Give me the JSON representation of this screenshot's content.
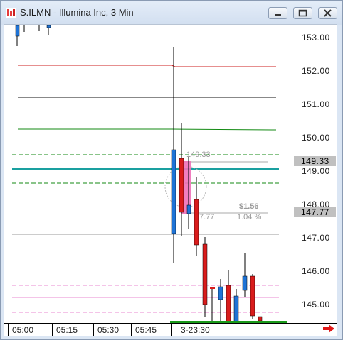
{
  "window": {
    "title": "S.ILMN - Illumina Inc, 3 Min",
    "accent_red": "#e53c3c",
    "icons": [
      "app-icon",
      "minimize-icon",
      "maximize-icon",
      "close-icon"
    ]
  },
  "price_axis": {
    "ticks": [
      "153.00",
      "152.00",
      "151.00",
      "150.00",
      "149.00",
      "148.00",
      "147.00",
      "146.00",
      "145.00"
    ],
    "upper_tag": "149.33",
    "lower_tag": "147.77"
  },
  "time_axis": {
    "labels": [
      "05:00",
      "05:15",
      "05:30",
      "05:45",
      "3-23:30"
    ]
  },
  "annotations": {
    "entry_price": "149.33",
    "exit_price": "7.77",
    "pnl": "$1.56",
    "pnl_pct": "1.04 %"
  },
  "colors": {
    "up_candle": "#1e73d6",
    "down_candle": "#d91c1c",
    "teal_line": "#1aa0a0",
    "green_line": "#138a13",
    "pink_line": "#e88ad0"
  }
}
